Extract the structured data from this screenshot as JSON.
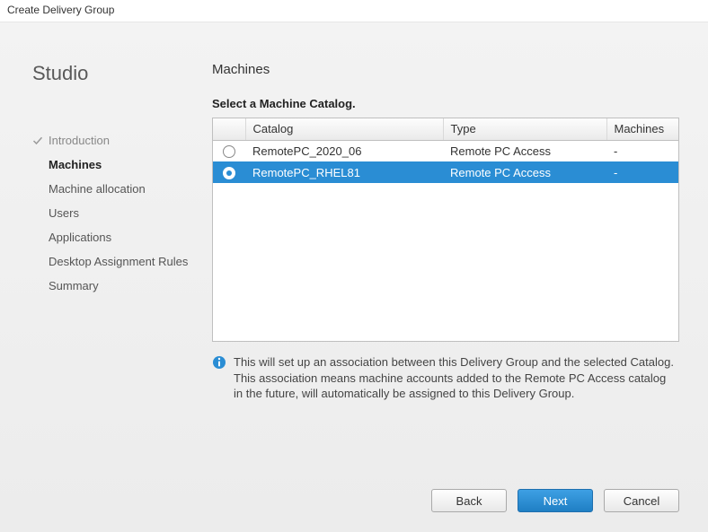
{
  "window": {
    "title": "Create Delivery Group"
  },
  "sidebar": {
    "heading": "Studio",
    "steps": [
      {
        "label": "Introduction",
        "state": "completed"
      },
      {
        "label": "Machines",
        "state": "current"
      },
      {
        "label": "Machine allocation",
        "state": "pending"
      },
      {
        "label": "Users",
        "state": "pending"
      },
      {
        "label": "Applications",
        "state": "pending"
      },
      {
        "label": "Desktop Assignment Rules",
        "state": "pending"
      },
      {
        "label": "Summary",
        "state": "pending"
      }
    ]
  },
  "page": {
    "title": "Machines",
    "select_label": "Select a Machine Catalog."
  },
  "table": {
    "headers": {
      "radio": "",
      "catalog": "Catalog",
      "type": "Type",
      "machines": "Machines"
    },
    "rows": [
      {
        "catalog": "RemotePC_2020_06",
        "type": "Remote PC Access",
        "machines": "-",
        "selected": false
      },
      {
        "catalog": "RemotePC_RHEL81",
        "type": "Remote PC Access",
        "machines": "-",
        "selected": true
      }
    ]
  },
  "info": {
    "text": "This will set up an association between this Delivery Group and the selected Catalog. This association means machine accounts added to the Remote PC Access catalog in the future, will automatically be assigned to this Delivery Group."
  },
  "buttons": {
    "back": "Back",
    "next": "Next",
    "cancel": "Cancel"
  },
  "icons": {
    "check": "check-icon",
    "info": "info-icon"
  },
  "colors": {
    "accent": "#2a8dd4"
  }
}
